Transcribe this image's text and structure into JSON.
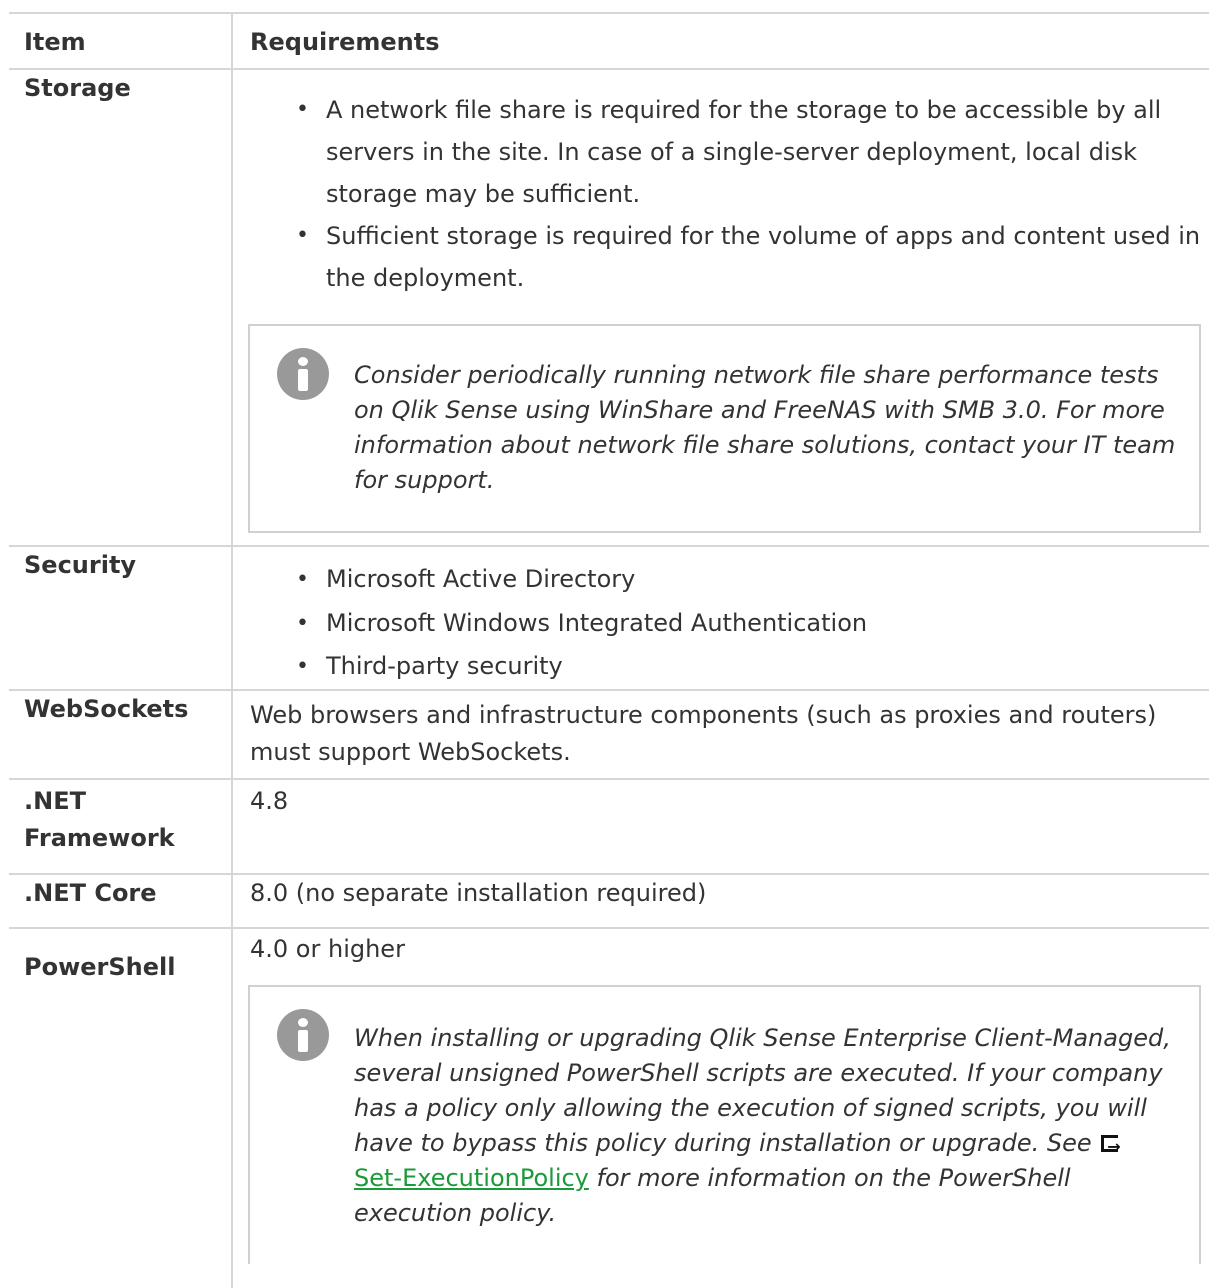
{
  "table": {
    "headers": {
      "item": "Item",
      "requirements": "Requirements"
    },
    "storage": {
      "item": "Storage",
      "bullets": [
        "A network file share is required for the storage to be accessible by all servers in the site. In case of a single-server deployment, local disk storage may be sufficient.",
        "Sufficient storage is required for the volume of apps and content used in the deployment."
      ],
      "note": "Consider periodically running network file share performance tests on Qlik Sense using WinShare and FreeNAS with SMB 3.0. For more information about network file share solutions, contact your IT team for support."
    },
    "security": {
      "item": "Security",
      "bullets": [
        "Microsoft Active Directory",
        "Microsoft Windows Integrated Authentication",
        "Third-party security"
      ]
    },
    "websockets": {
      "item": "WebSockets",
      "text": "Web browsers and infrastructure components (such as proxies and routers) must support WebSockets."
    },
    "netframework": {
      "item": ".NET Framework",
      "text": "4.8"
    },
    "netcore": {
      "item": ".NET Core",
      "text": "8.0 (no separate installation required)"
    },
    "powershell": {
      "item": "PowerShell",
      "text": "4.0 or higher",
      "note_before": "When installing or upgrading Qlik Sense Enterprise Client-Managed, several unsigned PowerShell scripts are executed. If your company has a policy only allowing the execution of signed scripts, you will have to bypass this policy during installation or upgrade. See",
      "link": "Set-ExecutionPolicy",
      "note_after": "for more information on the PowerShell execution policy."
    }
  },
  "icons": {
    "info": "info-icon",
    "external_link": "external-link-icon"
  },
  "colors": {
    "link": "#1a9a38",
    "icon": "#999999",
    "border": "#d6d6d6"
  }
}
